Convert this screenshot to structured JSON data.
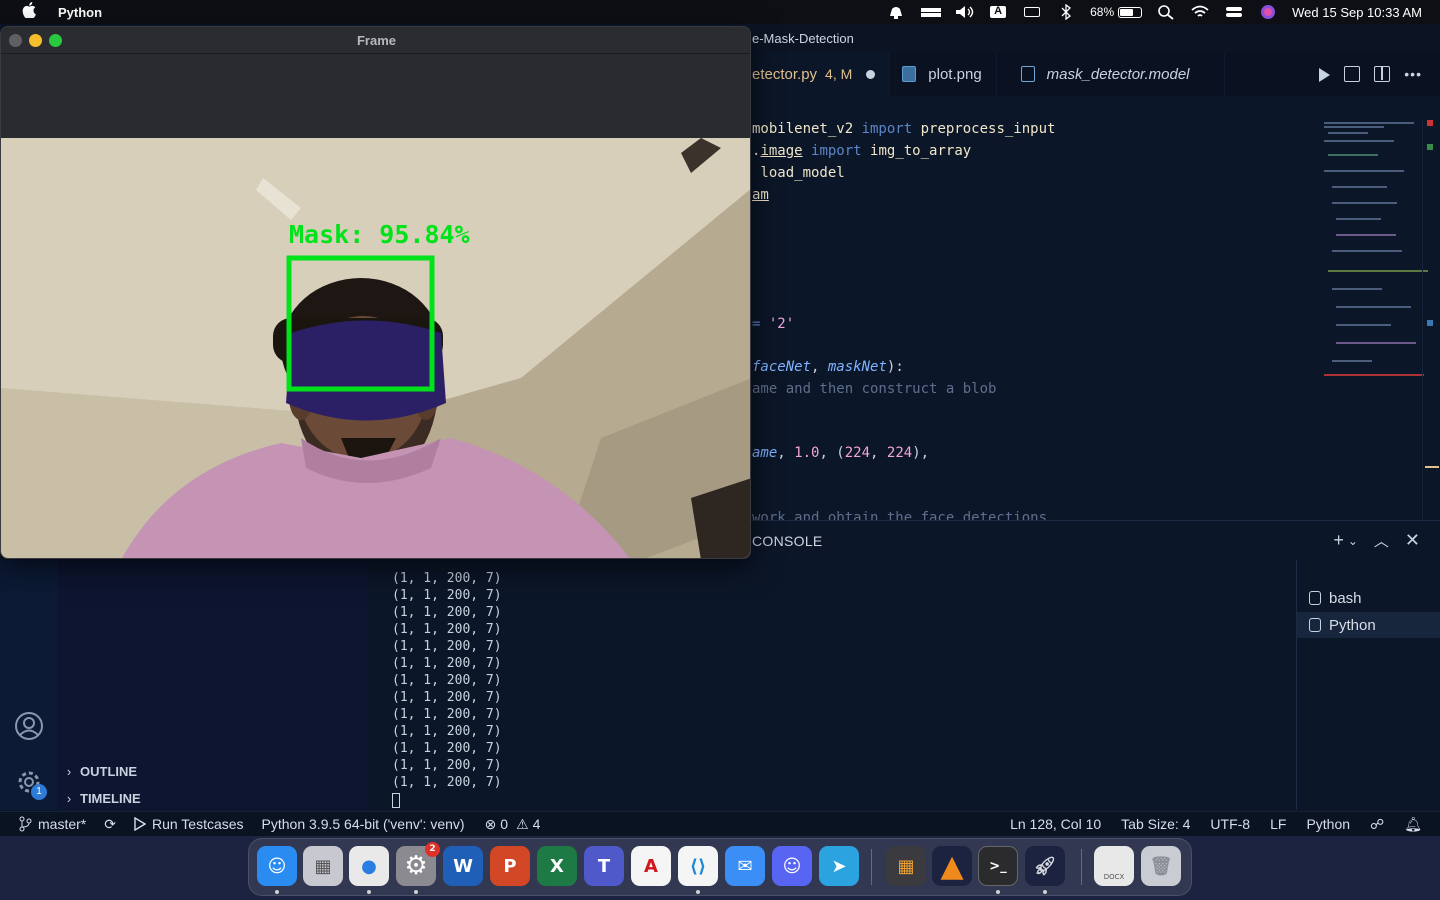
{
  "menubar": {
    "app_name": "Python",
    "battery_percent": "68%",
    "battery_level": 0.68,
    "clock": "Wed 15 Sep  10:33 AM"
  },
  "frame_window": {
    "title": "Frame",
    "detection_label": "Mask: 95.84%",
    "box_color": "#00e21a"
  },
  "vscode": {
    "title": "e-Mask-Detection",
    "tabs": [
      {
        "label": "etector.py",
        "badge": "4, M",
        "modified": true
      },
      {
        "label": "plot.png"
      },
      {
        "label": "mask_detector.model"
      }
    ],
    "code": {
      "l1": {
        "a": "mobilenet_v2 ",
        "b": "import",
        "c": " preprocess_input"
      },
      "l2": {
        "a": ".",
        "b": "image",
        "c": " import",
        "d": " img_to_array"
      },
      "l3": {
        "a": " load_model"
      },
      "l4": {
        "a": "am"
      },
      "l5": {
        "a": "= ",
        "b": "'2'"
      },
      "l6": {
        "a": "faceNet",
        "b": ", ",
        "c": "maskNet",
        "d": "):"
      },
      "l7": {
        "a": "ame and then construct a blob"
      },
      "l8": {
        "a": "ame",
        "b": ", ",
        "c": "1.0",
        "d": ", (",
        "e": "224",
        "f": ", ",
        "g": "224",
        "h": "),"
      },
      "l9": {
        "a": "work and obtain the face detections"
      }
    },
    "panel": {
      "title": "CONSOLE",
      "terminal_lines": [
        "(1, 1, 200, 7)",
        "(1, 1, 200, 7)",
        "(1, 1, 200, 7)",
        "(1, 1, 200, 7)",
        "(1, 1, 200, 7)",
        "(1, 1, 200, 7)",
        "(1, 1, 200, 7)",
        "(1, 1, 200, 7)",
        "(1, 1, 200, 7)",
        "(1, 1, 200, 7)",
        "(1, 1, 200, 7)",
        "(1, 1, 200, 7)",
        "(1, 1, 200, 7)"
      ],
      "terminals": [
        "bash",
        "Python"
      ]
    },
    "sidebar": {
      "outline": "OUTLINE",
      "timeline": "TIMELINE",
      "settings_badge": "1"
    },
    "statusbar": {
      "branch": "master*",
      "run": "Run Testcases",
      "interpreter": "Python 3.9.5 64-bit ('venv': venv)",
      "errors": "0",
      "warnings": "4",
      "position": "Ln 128, Col 10",
      "tab_size": "Tab Size: 4",
      "encoding": "UTF-8",
      "eol": "LF",
      "language": "Python"
    }
  },
  "dock": {
    "apps": [
      {
        "name": "finder",
        "icon": "finder-icon",
        "color": "#2a8cf0"
      },
      {
        "name": "launchpad",
        "icon": "launchpad-icon",
        "color": "#c8c8d0"
      },
      {
        "name": "chrome",
        "icon": "chrome-icon",
        "color": "#e9e9e9"
      },
      {
        "name": "system-preferences",
        "icon": "gear-icon",
        "color": "#8a8a90",
        "badge": "2"
      },
      {
        "name": "word",
        "icon": "word-icon",
        "color": "#1f5fb8"
      },
      {
        "name": "powerpoint",
        "icon": "powerpoint-icon",
        "color": "#d24726"
      },
      {
        "name": "excel",
        "icon": "excel-icon",
        "color": "#1d7a44"
      },
      {
        "name": "teams",
        "icon": "teams-icon",
        "color": "#5059c9"
      },
      {
        "name": "acrobat",
        "icon": "acrobat-icon",
        "color": "#f5f5f5"
      },
      {
        "name": "vscode",
        "icon": "vscode-icon",
        "color": "#f5f5f5"
      },
      {
        "name": "mail",
        "icon": "mail-icon",
        "color": "#3a8ef6"
      },
      {
        "name": "discord",
        "icon": "discord-icon",
        "color": "#5865f2"
      },
      {
        "name": "telegram",
        "icon": "telegram-icon",
        "color": "#2aa3e0"
      },
      {
        "name": "calculator",
        "icon": "calculator-icon",
        "color": "#3b3b3f"
      },
      {
        "name": "vlc",
        "icon": "vlc-icon",
        "color": "#1b2340"
      },
      {
        "name": "terminal",
        "icon": "terminal-icon",
        "color": "#2b2b2e"
      },
      {
        "name": "rocket",
        "icon": "rocket-icon",
        "color": "#1b2340"
      },
      {
        "name": "document",
        "icon": "document-icon",
        "color": "#e8e8e8",
        "label": "DOCX"
      },
      {
        "name": "trash",
        "icon": "trash-icon",
        "color": "#c9ccd2"
      }
    ],
    "symbols": {
      "word": "W",
      "powerpoint": "P",
      "excel": "X",
      "teams": "T",
      "terminal": ">_",
      "acrobat": "A",
      "calculator": "=",
      "chrome": "●",
      "mail": "✉",
      "discord": "☺",
      "telegram": "➤"
    }
  }
}
